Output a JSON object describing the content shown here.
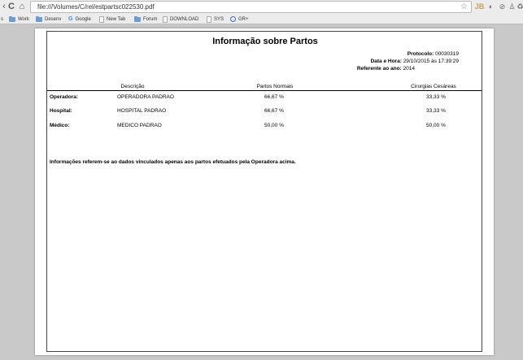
{
  "browser": {
    "url": "file:///Volumes/C/rel/estpartsc022530.pdf",
    "back_glyph": "‹",
    "reload_glyph": "C",
    "home_glyph": "⌂",
    "star_glyph": "☆",
    "extensions": [
      "JB",
      "◐",
      "⊘",
      "♙",
      "♻"
    ],
    "bookmarks": [
      {
        "label": "s",
        "icon": "none"
      },
      {
        "label": "Work",
        "icon": "folder"
      },
      {
        "label": "Desenv",
        "icon": "folder"
      },
      {
        "label": "Google",
        "icon": "google"
      },
      {
        "label": "New Tab",
        "icon": "page"
      },
      {
        "label": "Forum",
        "icon": "folder"
      },
      {
        "label": "DOWNLOAD",
        "icon": "page"
      },
      {
        "label": "SYS",
        "icon": "page"
      },
      {
        "label": "GR+",
        "icon": "globe"
      }
    ]
  },
  "report": {
    "title": "Informação sobre Partos",
    "protocolo_label": "Protocolo:",
    "protocolo_value": "00030319",
    "datahora_label": "Data e Hora:",
    "datahora_value": "29/10/2015 às 17:39:29",
    "referente_label": "Referente ao ano:",
    "referente_value": "2014",
    "columns": {
      "descricao": "Descrição",
      "partos_normais": "Partos Normais",
      "cirurgias_cesareas": "Cirurgias Cesáreas"
    },
    "rows": [
      {
        "label": "Operadora:",
        "descricao": "OPERADORA PADRAO",
        "partos_normais": "66,67 %",
        "cirurgias_cesareas": "33,33 %"
      },
      {
        "label": "Hospital:",
        "descricao": "HOSPITAL PADRAO",
        "partos_normais": "66,67 %",
        "cirurgias_cesareas": "33,33 %"
      },
      {
        "label": "Médico:",
        "descricao": "MEDICO PADRAO",
        "partos_normais": "50,00 %",
        "cirurgias_cesareas": "50,00 %"
      }
    ],
    "footnote": "Informações referem-se ao dados vinculados apenas aos partos efetuados pela Operadora acima."
  }
}
